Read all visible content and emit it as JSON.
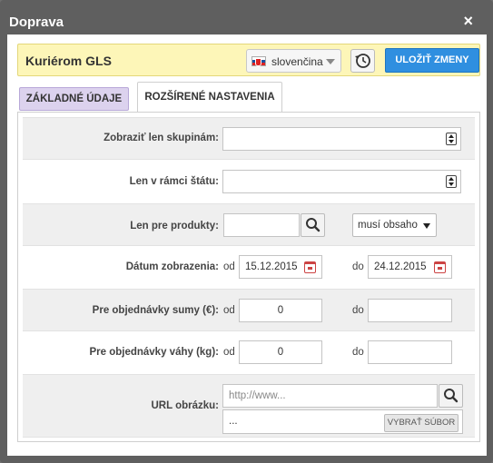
{
  "dialog": {
    "title": "Doprava",
    "close_symbol": "×"
  },
  "header": {
    "carrier_name": "Kuriérom GLS",
    "language": "slovenčina",
    "language_flag": "slovak-flag-icon",
    "history_icon": "history-icon",
    "save_label": "ULOŽIŤ ZMENY"
  },
  "tabs": [
    {
      "label": "ZÁKLADNÉ ÚDAJE",
      "active": false
    },
    {
      "label": "ROZŠÍRENÉ NASTAVENIA",
      "active": true
    }
  ],
  "form": {
    "groups_label": "Zobraziť len skupinám:",
    "groups_value": "",
    "state_label": "Len v rámci štátu:",
    "state_value": "",
    "products_label": "Len pre produkty:",
    "products_value": "",
    "products_mode": "musí obsaho",
    "date_label": "Dátum zobrazenia:",
    "from_label": "od",
    "to_label": "do",
    "date_from": "15.12.2015",
    "date_to": "24.12.2015",
    "sum_label": "Pre objednávky sumy (€):",
    "sum_from": "0",
    "sum_to": "",
    "weight_label": "Pre objednávky váhy (kg):",
    "weight_from": "0",
    "weight_to": "",
    "url_label": "URL obrázku:",
    "url_placeholder": "http://www...",
    "file_value": "...",
    "browse_label": "VYBRAŤ SÚBOR"
  },
  "colors": {
    "header_bg": "#fdf6b8",
    "save_button": "#2f8fe0",
    "basic_tab": "#dcd2ee"
  }
}
